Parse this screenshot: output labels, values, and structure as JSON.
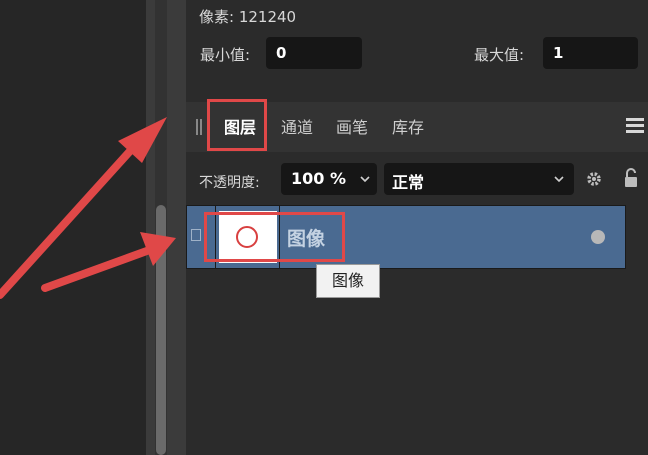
{
  "stats": {
    "pixels_label": "像素:",
    "pixels_value": "121240",
    "min_label": "最小值:",
    "min_value": "0",
    "max_label": "最大值:",
    "max_value": "1"
  },
  "tabs": [
    {
      "label": "图层",
      "active": true
    },
    {
      "label": "通道",
      "active": false
    },
    {
      "label": "画笔",
      "active": false
    },
    {
      "label": "库存",
      "active": false
    }
  ],
  "controls": {
    "opacity_label": "不透明度:",
    "opacity_value": "100 %",
    "blend_mode": "正常"
  },
  "layer": {
    "name": "图像",
    "selected": true
  },
  "tooltip": "图像",
  "icons": [
    "grip-icon",
    "hamburger-menu-icon",
    "chevron-down-icon",
    "gear-icon",
    "lock-icon",
    "layer-type-icon",
    "visibility-dot-icon"
  ],
  "colors": {
    "panel_bg": "#2b2b2b",
    "selected_row": "#4a6a91",
    "annotation_red": "#e04848"
  }
}
